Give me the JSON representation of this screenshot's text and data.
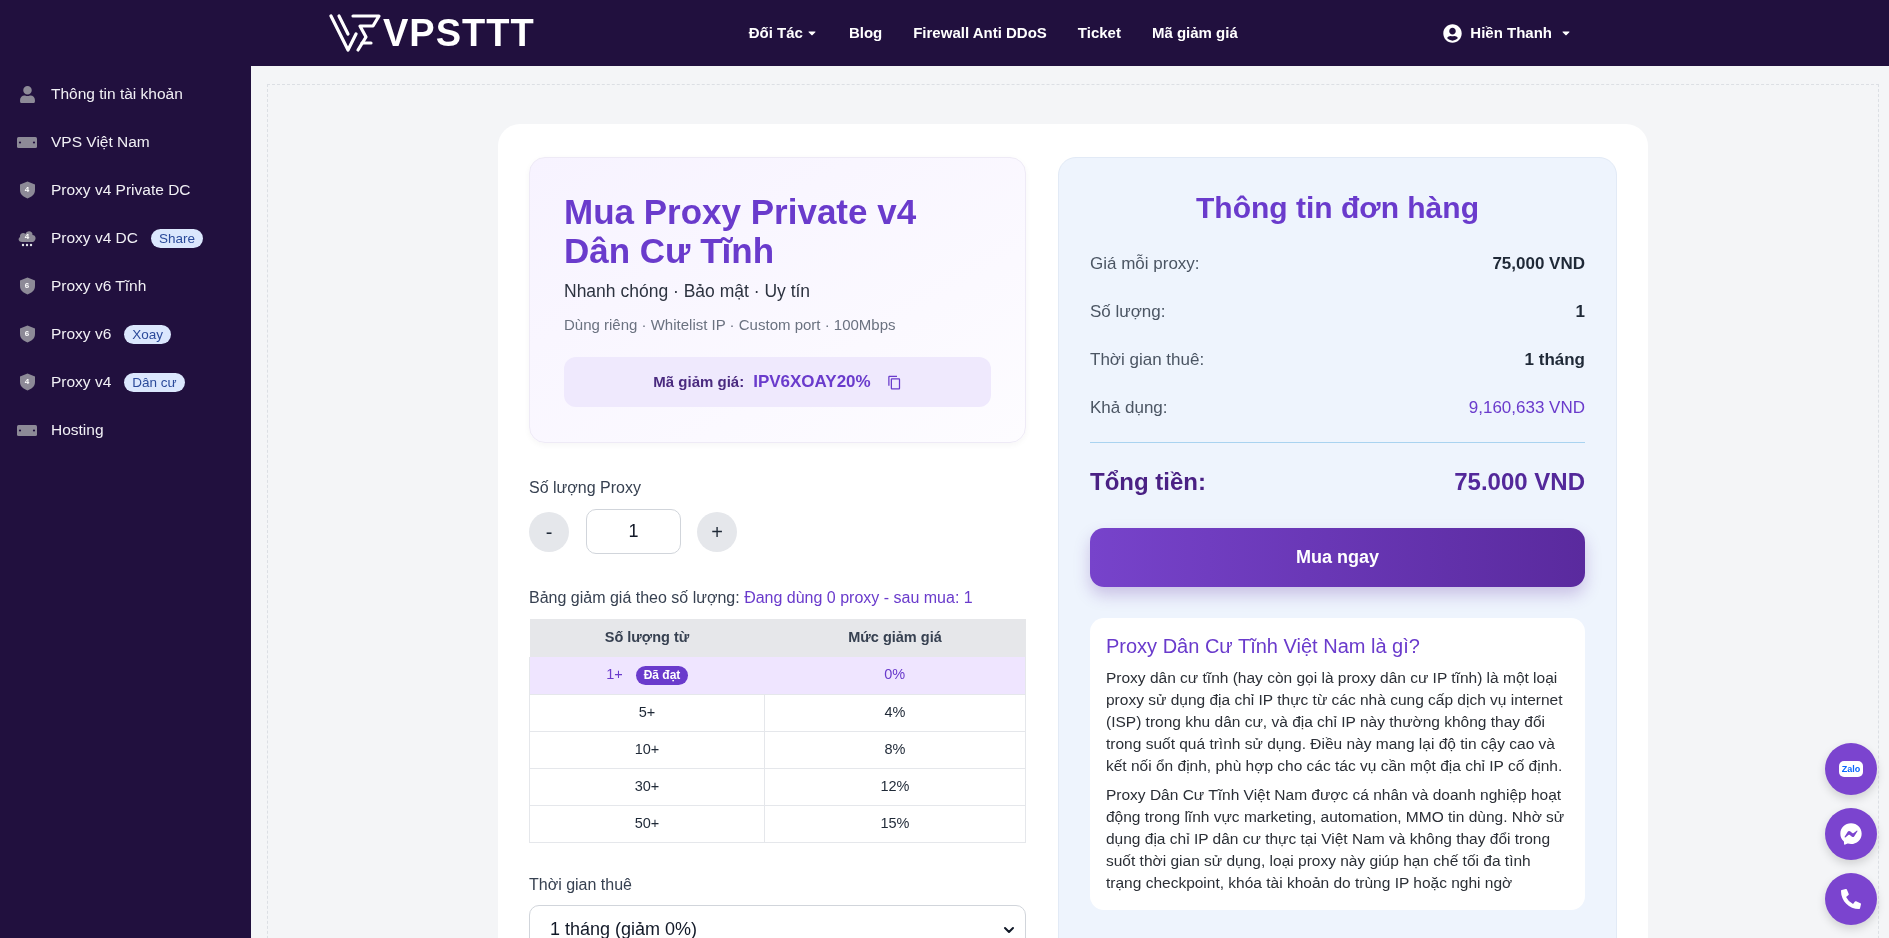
{
  "header": {
    "brand": {
      "name": "VPSTTT"
    },
    "nav": [
      {
        "label": "Đối Tác",
        "has_dropdown": true
      },
      {
        "label": "Blog",
        "has_dropdown": false
      },
      {
        "label": "Firewall Anti DDoS",
        "has_dropdown": false
      },
      {
        "label": "Ticket",
        "has_dropdown": false
      },
      {
        "label": "Mã giảm giá",
        "has_dropdown": false
      }
    ],
    "user": {
      "name": "Hiền Thanh",
      "has_dropdown": true
    }
  },
  "sidebar": {
    "items": [
      {
        "label": "Thông tin tài khoản"
      },
      {
        "label": "VPS Việt Nam"
      },
      {
        "label": "Proxy v4 Private DC",
        "icon_text": "4"
      },
      {
        "label": "Proxy v4 DC",
        "icon_text": "4",
        "badge": "Share"
      },
      {
        "label": "Proxy v6 Tĩnh",
        "icon_text": "6"
      },
      {
        "label": "Proxy v6",
        "icon_text": "6",
        "badge": "Xoay"
      },
      {
        "label": "Proxy v4",
        "icon_text": "4",
        "badge": "Dân cư"
      },
      {
        "label": "Hosting"
      }
    ]
  },
  "product": {
    "title": "Mua Proxy Private v4 Dân Cư Tĩnh",
    "subtitle": "Nhanh chóng · Bảo mật · Uy tín",
    "features": "Dùng riêng · Whitelist IP · Custom port · 100Mbps",
    "coupon": {
      "label": "Mã giảm giá:",
      "code": "IPV6XOAY20%"
    }
  },
  "quantity": {
    "label": "Số lượng Proxy",
    "decrement": "-",
    "value": "1",
    "increment": "+"
  },
  "discount_table": {
    "label": "Bảng giảm giá theo số lượng:",
    "status": "Đang dùng 0 proxy - sau mua: 1",
    "columns": [
      "Số lượng từ",
      "Mức giảm giá"
    ],
    "rows": [
      {
        "from": "1+",
        "discount": "0%",
        "achieved": true,
        "badge": "Đã đạt"
      },
      {
        "from": "5+",
        "discount": "4%",
        "achieved": false
      },
      {
        "from": "10+",
        "discount": "8%",
        "achieved": false
      },
      {
        "from": "30+",
        "discount": "12%",
        "achieved": false
      },
      {
        "from": "50+",
        "discount": "15%",
        "achieved": false
      }
    ]
  },
  "rental": {
    "label": "Thời gian thuê",
    "value": "1 tháng (giảm 0%)"
  },
  "order": {
    "title": "Thông tin đơn hàng",
    "rows": [
      {
        "label": "Giá mỗi proxy:",
        "value": "75,000 VND",
        "kind": "plain"
      },
      {
        "label": "Số lượng:",
        "value": "1",
        "kind": "plain"
      },
      {
        "label": "Thời gian thuê:",
        "value": "1 tháng",
        "kind": "plain"
      },
      {
        "label": "Khả dụng:",
        "value": "9,160,633 VND",
        "kind": "balance"
      }
    ],
    "total": {
      "label": "Tổng tiền:",
      "value": "75.000 VND"
    },
    "buy_button": "Mua ngay"
  },
  "info": {
    "title": "Proxy Dân Cư Tĩnh Việt Nam là gì?",
    "paragraphs": [
      "Proxy dân cư tĩnh (hay còn gọi là proxy dân cư IP tĩnh) là một loại proxy sử dụng địa chỉ IP thực từ các nhà cung cấp dịch vụ internet (ISP) trong khu dân cư, và địa chỉ IP này thường không thay đổi trong suốt quá trình sử dụng. Điều này mang lại độ tin cậy cao và kết nối ổn định, phù hợp cho các tác vụ cần một địa chỉ IP cố định.",
      "Proxy Dân Cư Tĩnh Việt Nam được cá nhân và doanh nghiệp hoạt động trong lĩnh vực marketing, automation, MMO tin dùng. Nhờ sử dụng địa chỉ IP dân cư thực tại Việt Nam và không thay đổi trong suốt thời gian sử dụng, loại proxy này giúp hạn chế tối đa tình trạng checkpoint, khóa tài khoản do trùng IP hoặc nghi ngờ"
    ]
  },
  "floating_buttons": [
    {
      "kind": "zalo",
      "label": "Zalo"
    },
    {
      "kind": "messenger"
    },
    {
      "kind": "phone"
    }
  ]
}
